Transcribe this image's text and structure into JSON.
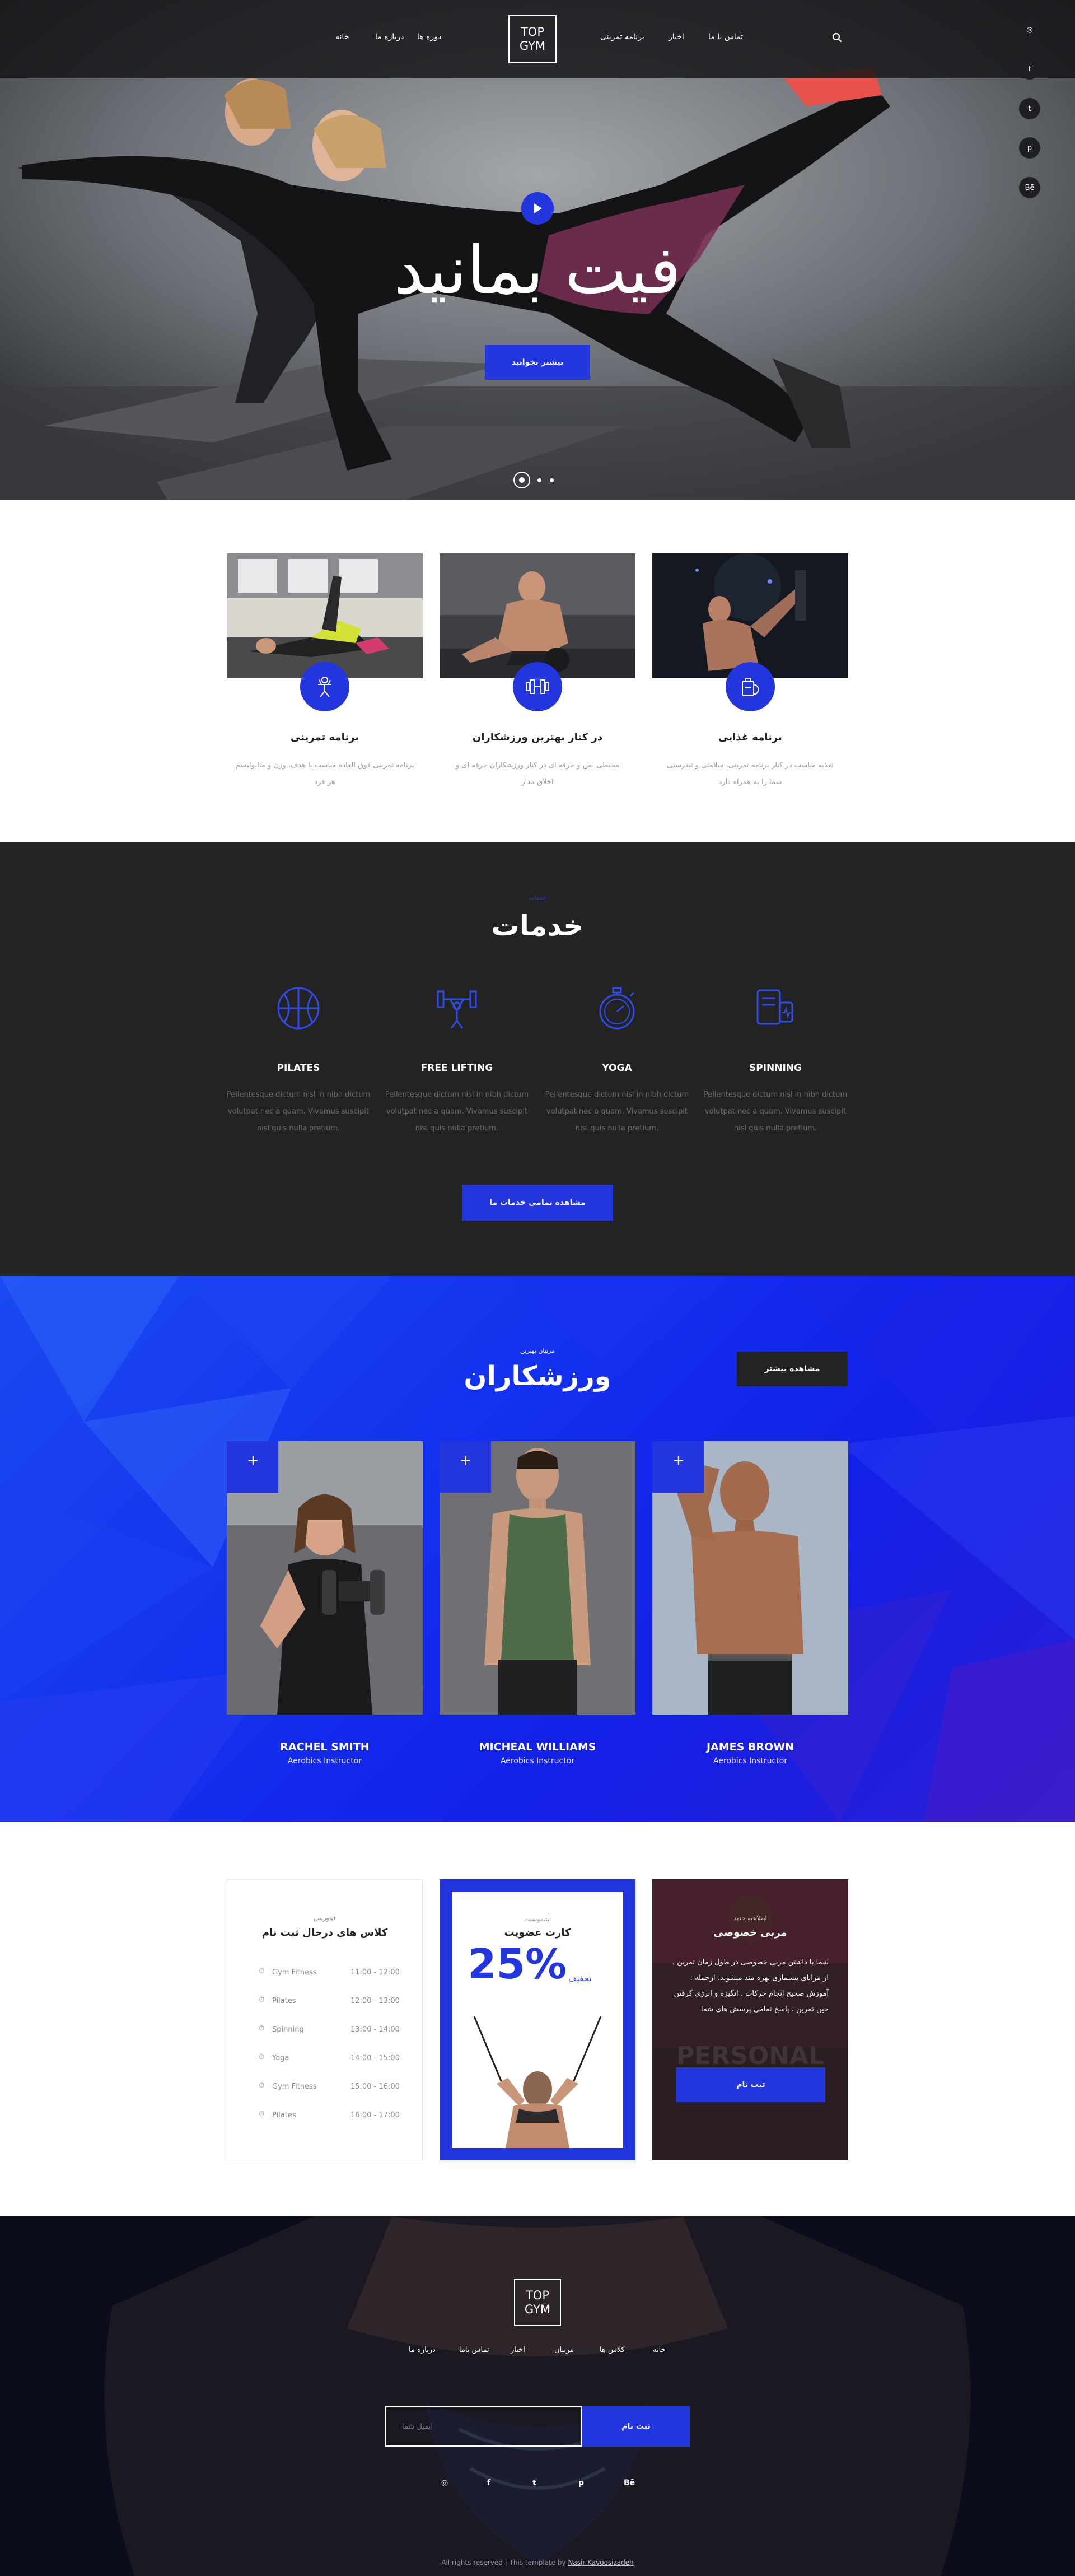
{
  "nav": {
    "items": [
      "خانه",
      "درباره ما",
      "دوره ها",
      "برنامه تمرینی",
      "اخبار",
      "تماس با ما"
    ],
    "logo_line1": "TOP",
    "logo_line2": "GYM"
  },
  "social": {
    "icons": [
      "dribbble-icon",
      "facebook-icon",
      "twitter-icon",
      "pinterest-icon",
      "behance-icon"
    ],
    "glyphs": [
      "◎",
      "f",
      "t",
      "p",
      "Bē"
    ]
  },
  "hero": {
    "title": "فیت بمانید",
    "button": "بیشتر بخوانید",
    "slide_count": 3,
    "active_slide": 1
  },
  "features": [
    {
      "title": "برنامه تمرینی",
      "text": "برنامه تمرینی فوق العاده مناسب با هدف، وزن و متابولیسم هر فرد"
    },
    {
      "title": "در کنار بهترین ورزشکاران",
      "text": "محیطی امن و حرفه ای در کنار ورزشکاران حرفه ای و اخلاق مدار"
    },
    {
      "title": "برنامه غذایی",
      "text": "تغذیه مناسب در کنار برنامه تمرینی، سلامتی و تندرستی شما را به همراه دارد"
    }
  ],
  "services": {
    "subtitle": "خدمات",
    "title": "خدمات",
    "items": [
      {
        "title": "PILATES",
        "text": "Pellentesque dictum nisl in nibh dictum volutpat nec a quam. Vivamus suscipit nisl quis nulla pretium."
      },
      {
        "title": "FREE LIFTING",
        "text": "Pellentesque dictum nisl in nibh dictum volutpat nec a quam. Vivamus suscipit nisl quis nulla pretium."
      },
      {
        "title": "YOGA",
        "text": "Pellentesque dictum nisl in nibh dictum volutpat nec a quam. Vivamus suscipit nisl quis nulla pretium."
      },
      {
        "title": "SPINNING",
        "text": "Pellentesque dictum nisl in nibh dictum volutpat nec a quam. Vivamus suscipit nisl quis nulla pretium."
      }
    ],
    "button": "مشاهده تمامی خدمات ما"
  },
  "trainers": {
    "subtitle": "مربیان بهترین",
    "title": "ورزشکاران",
    "more_button": "مشاهده بیشتر",
    "plus": "+",
    "items": [
      {
        "name": "RACHEL SMITH",
        "role": "Aerobics Instructor"
      },
      {
        "name": "MICHEAL WILLIAMS",
        "role": "Aerobics Instructor"
      },
      {
        "name": "JAMES BROWN",
        "role": "Aerobics Instructor"
      }
    ]
  },
  "schedule": {
    "subtitle": "فیتوریس",
    "title": "کلاس های درحال ثبت نام",
    "rows": [
      {
        "name": "Gym Fitness",
        "time": "11:00 - 12:00"
      },
      {
        "name": "Pilates",
        "time": "12:00 - 13:00"
      },
      {
        "name": "Spinning",
        "time": "13:00 - 14:00"
      },
      {
        "name": "Yoga",
        "time": "14:00 - 15:00"
      },
      {
        "name": "Gym Fitness",
        "time": "15:00 - 16:00"
      },
      {
        "name": "Pilates",
        "time": "16:00 - 17:00"
      }
    ]
  },
  "membership": {
    "subtitle": "اپتیموسیت",
    "title": "کارت عضویت",
    "percent": "25%",
    "discount": "تخفیف"
  },
  "personal": {
    "subtitle": "اطلاعیه جدید",
    "title": "مربی خصوصی",
    "text": "شما با داشتن مربی خصوصی در طول زمان تمرین ، از مزایای بیشماری بهره مند میشوید. ازجمله : آموزش صحیح انجام حرکات ، انگیزه و انرژی گرفتن حین تمرین ، پاسخ تمامی پرسش های شما",
    "poster_word": "PERSONAL",
    "button": "ثبت نام"
  },
  "footer": {
    "logo_line1": "TOP",
    "logo_line2": "GYM",
    "links": [
      "خانه",
      "کلاس ها",
      "مربیان",
      "اخبار",
      "تماس باما",
      "درباره ما"
    ],
    "email_placeholder": "ایمیل شما",
    "subscribe_button": "ثبت نام",
    "social_glyphs": [
      "◎",
      "f",
      "t",
      "p",
      "Bē"
    ],
    "copyright": "All rights reserved | This template by",
    "author": "Nasir Kavoosizadeh"
  },
  "colors": {
    "accent": "#2336de",
    "dark": "#232323",
    "footer": "#0b0d1d"
  }
}
